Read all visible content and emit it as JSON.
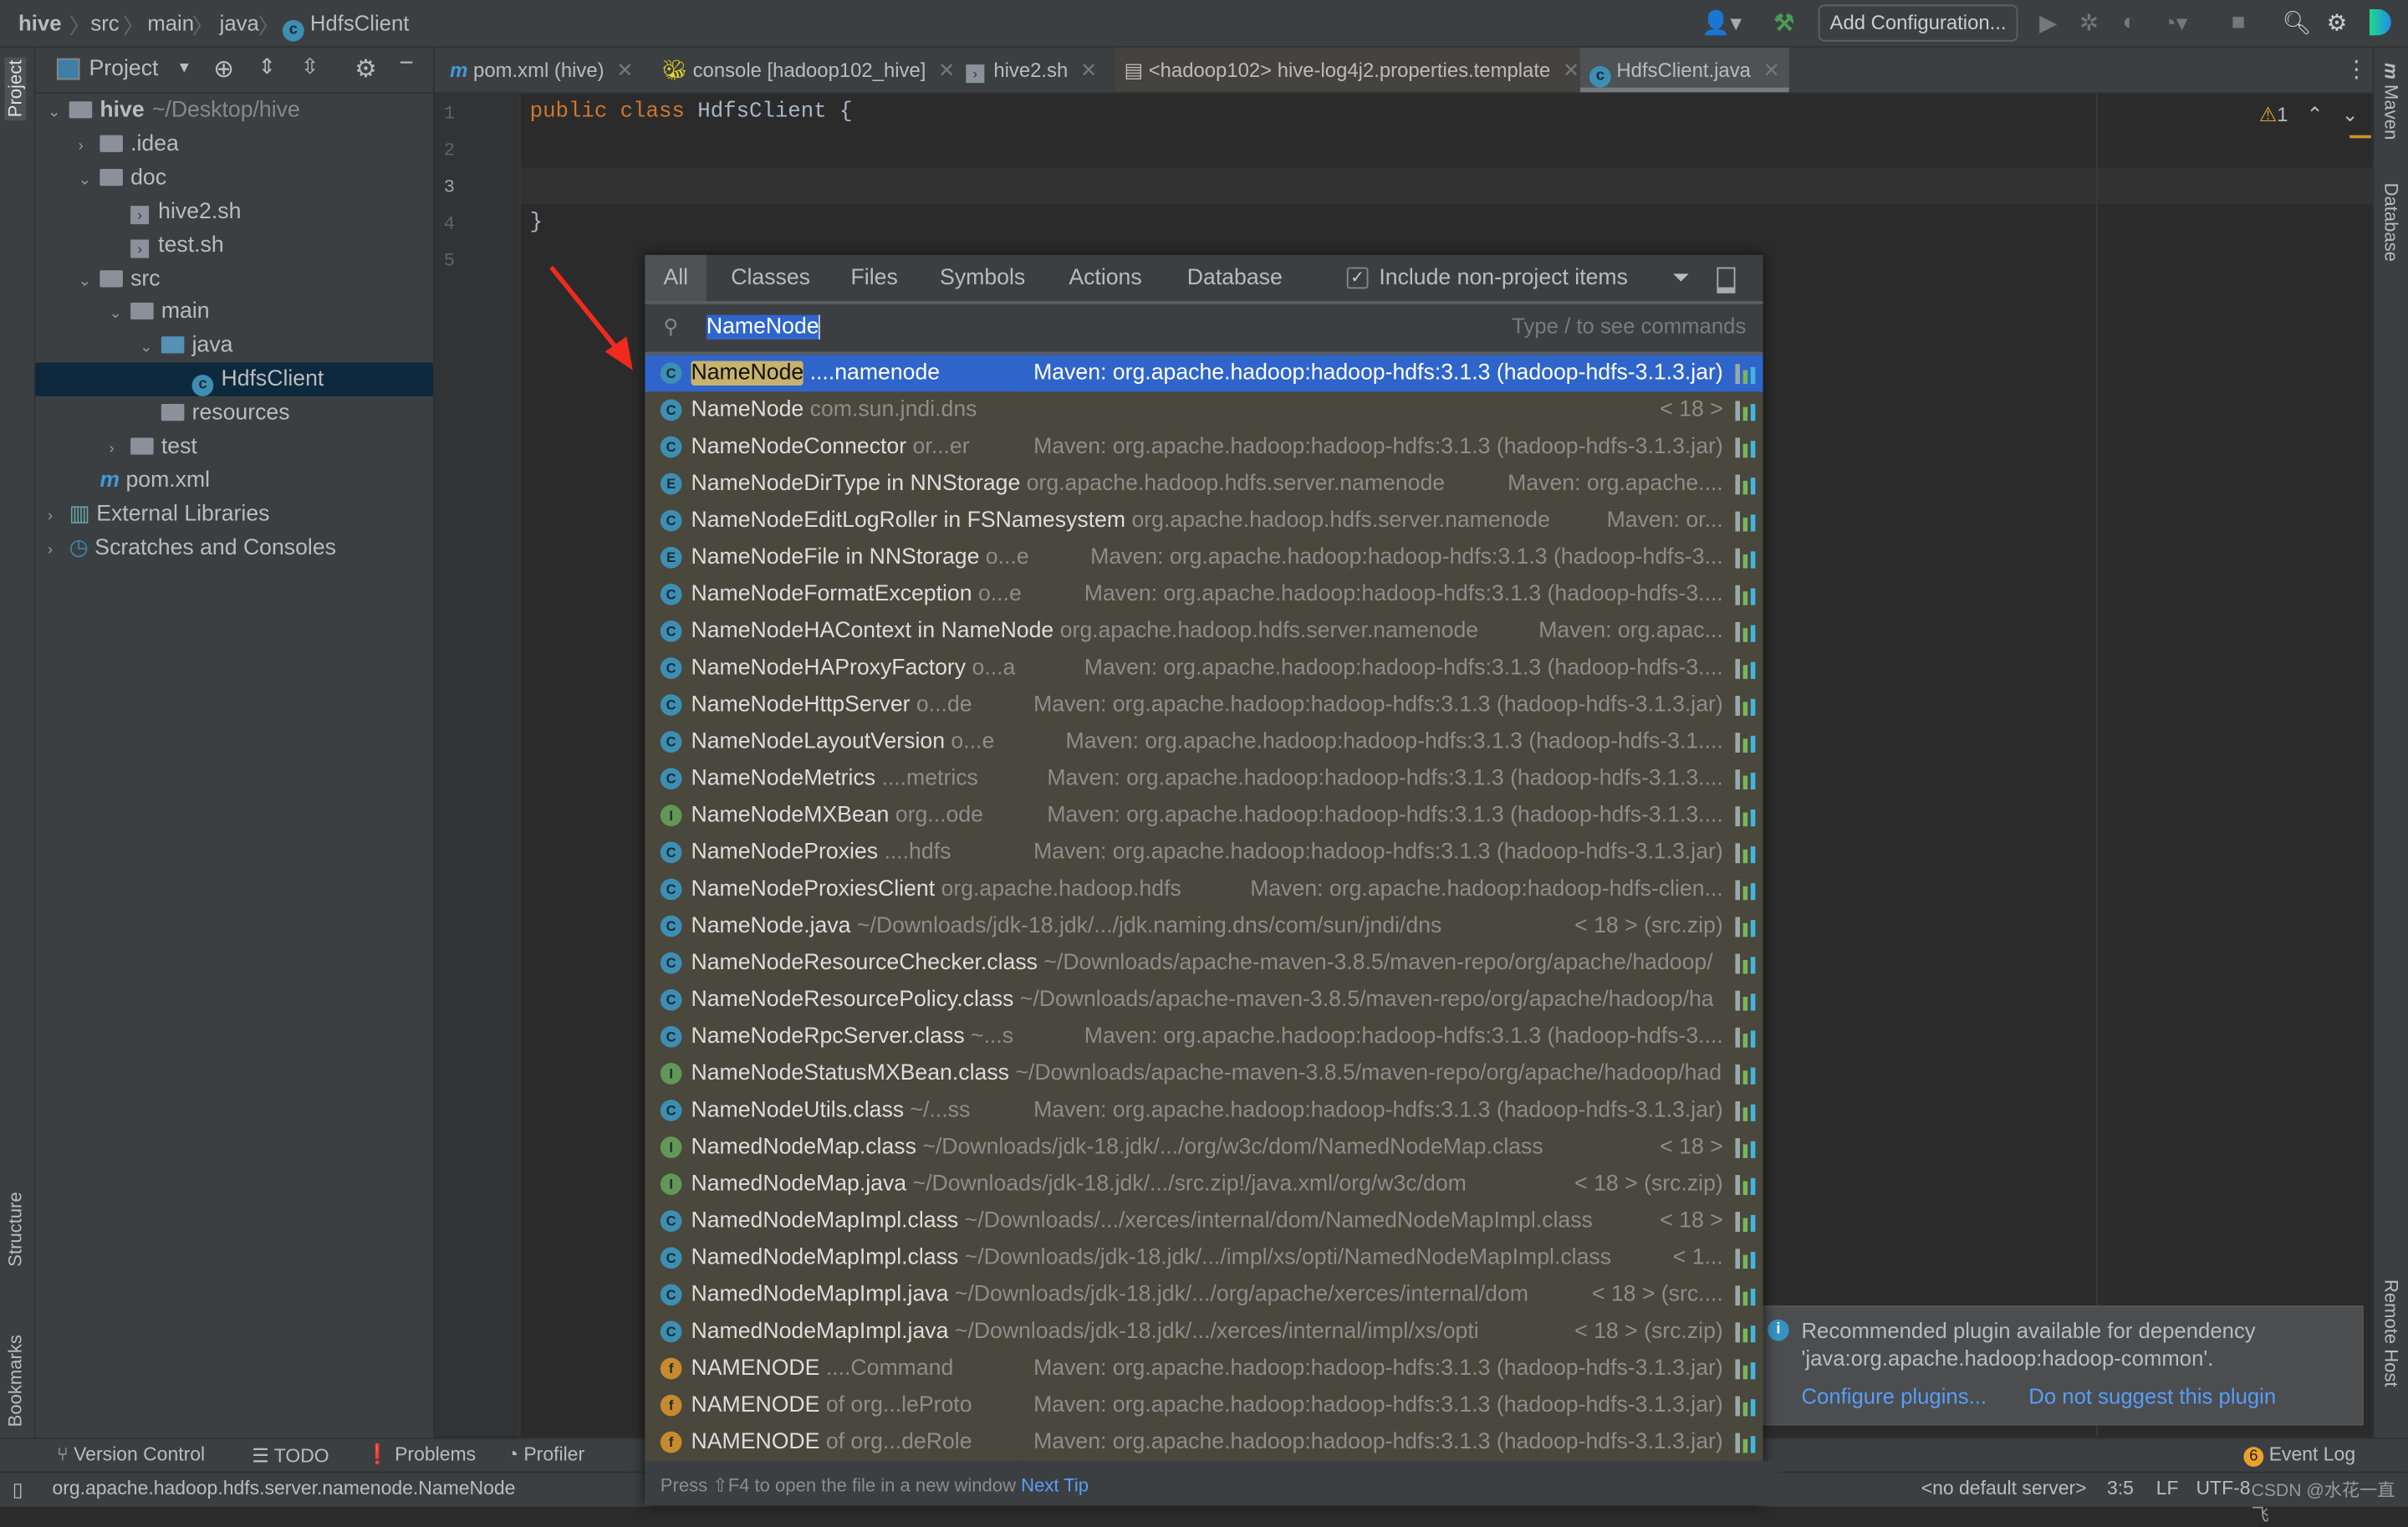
{
  "breadcrumb": [
    "hive",
    "src",
    "main",
    "java",
    "HdfsClient"
  ],
  "toolbar": {
    "add_configuration": "Add Configuration..."
  },
  "left_strip": {
    "project": "Project",
    "structure": "Structure",
    "bookmarks": "Bookmarks"
  },
  "right_strip": {
    "maven": "Maven",
    "database": "Database",
    "remote_host": "Remote Host"
  },
  "project_panel": {
    "title": "Project",
    "tree": [
      {
        "label": "hive",
        "extra": "~/Desktop/hive",
        "depth": 0,
        "type": "folder",
        "arrow": "down",
        "bold": true
      },
      {
        "label": ".idea",
        "depth": 1,
        "type": "folder",
        "arrow": "right"
      },
      {
        "label": "doc",
        "depth": 1,
        "type": "folder",
        "arrow": "down"
      },
      {
        "label": "hive2.sh",
        "depth": 2,
        "type": "sh"
      },
      {
        "label": "test.sh",
        "depth": 2,
        "type": "sh"
      },
      {
        "label": "src",
        "depth": 1,
        "type": "folder",
        "arrow": "down"
      },
      {
        "label": "main",
        "depth": 2,
        "type": "folder",
        "arrow": "down"
      },
      {
        "label": "java",
        "depth": 3,
        "type": "folder-blue",
        "arrow": "down"
      },
      {
        "label": "HdfsClient",
        "depth": 4,
        "type": "class",
        "selected": true
      },
      {
        "label": "resources",
        "depth": 3,
        "type": "folder"
      },
      {
        "label": "test",
        "depth": 2,
        "type": "folder",
        "arrow": "right"
      },
      {
        "label": "pom.xml",
        "depth": 1,
        "type": "maven"
      },
      {
        "label": "External Libraries",
        "depth": 0,
        "type": "lib",
        "arrow": "right"
      },
      {
        "label": "Scratches and Consoles",
        "depth": 0,
        "type": "scratch",
        "arrow": "right"
      }
    ]
  },
  "editor_tabs": [
    {
      "label": "pom.xml (hive)",
      "icon": "maven-icon"
    },
    {
      "label": "console [hadoop102_hive]",
      "icon": "hive-icon"
    },
    {
      "label": "hive2.sh",
      "icon": "shell-icon"
    },
    {
      "label": "<hadoop102> hive-log4j2.properties.template",
      "icon": "file-icon"
    },
    {
      "label": "HdfsClient.java",
      "icon": "class-icon",
      "active": true
    }
  ],
  "editor": {
    "lines": [
      "1",
      "2",
      "3",
      "4",
      "5"
    ],
    "code_line1_kw": "public class",
    "code_line1_name": " HdfsClient {",
    "code_line4": "}",
    "warnings": "1"
  },
  "search_popup": {
    "tabs": [
      "All",
      "Classes",
      "Files",
      "Symbols",
      "Actions",
      "Database"
    ],
    "include_non_project": "Include non-project items",
    "include_checked": true,
    "query": "NameNode",
    "hint": "Type / to see commands",
    "results": [
      {
        "icon": "C",
        "name": "NameNode",
        "detail": " ....namenode",
        "right": "Maven: org.apache.hadoop:hadoop-hdfs:3.1.3 (hadoop-hdfs-3.1.3.jar)",
        "selected": true
      },
      {
        "icon": "C",
        "name": "NameNode",
        "detail": " com.sun.jndi.dns",
        "right": "< 18 >"
      },
      {
        "icon": "C",
        "name": "NameNodeConnector",
        "detail": " or...er",
        "right": "Maven: org.apache.hadoop:hadoop-hdfs:3.1.3 (hadoop-hdfs-3.1.3.jar)"
      },
      {
        "icon": "E",
        "name": "NameNodeDirType in NNStorage",
        "detail": " org.apache.hadoop.hdfs.server.namenode",
        "right": "Maven: org.apache...."
      },
      {
        "icon": "C",
        "name": "NameNodeEditLogRoller in FSNamesystem",
        "detail": " org.apache.hadoop.hdfs.server.namenode",
        "right": "Maven: or..."
      },
      {
        "icon": "E",
        "name": "NameNodeFile in NNStorage",
        "detail": " o...e",
        "right": "Maven: org.apache.hadoop:hadoop-hdfs:3.1.3 (hadoop-hdfs-3..."
      },
      {
        "icon": "C",
        "name": "NameNodeFormatException",
        "detail": " o...e",
        "right": "Maven: org.apache.hadoop:hadoop-hdfs:3.1.3 (hadoop-hdfs-3...."
      },
      {
        "icon": "C",
        "name": "NameNodeHAContext in NameNode",
        "detail": " org.apache.hadoop.hdfs.server.namenode",
        "right": "Maven: org.apac..."
      },
      {
        "icon": "C",
        "name": "NameNodeHAProxyFactory",
        "detail": " o...a",
        "right": "Maven: org.apache.hadoop:hadoop-hdfs:3.1.3 (hadoop-hdfs-3...."
      },
      {
        "icon": "C",
        "name": "NameNodeHttpServer",
        "detail": " o...de",
        "right": "Maven: org.apache.hadoop:hadoop-hdfs:3.1.3 (hadoop-hdfs-3.1.3.jar)"
      },
      {
        "icon": "C",
        "name": "NameNodeLayoutVersion",
        "detail": " o...e",
        "right": "Maven: org.apache.hadoop:hadoop-hdfs:3.1.3 (hadoop-hdfs-3.1...."
      },
      {
        "icon": "C",
        "name": "NameNodeMetrics",
        "detail": " ....metrics",
        "right": "Maven: org.apache.hadoop:hadoop-hdfs:3.1.3 (hadoop-hdfs-3.1.3...."
      },
      {
        "icon": "I",
        "name": "NameNodeMXBean",
        "detail": " org...ode",
        "right": "Maven: org.apache.hadoop:hadoop-hdfs:3.1.3 (hadoop-hdfs-3.1.3...."
      },
      {
        "icon": "C",
        "name": "NameNodeProxies",
        "detail": " ....hdfs",
        "right": "Maven: org.apache.hadoop:hadoop-hdfs:3.1.3 (hadoop-hdfs-3.1.3.jar)"
      },
      {
        "icon": "C",
        "name": "NameNodeProxiesClient",
        "detail": " org.apache.hadoop.hdfs",
        "right": "Maven: org.apache.hadoop:hadoop-hdfs-clien..."
      },
      {
        "icon": "C",
        "name": "NameNode.java",
        "detail": " ~/Downloads/jdk-18.jdk/.../jdk.naming.dns/com/sun/jndi/dns",
        "right": "< 18 > (src.zip)"
      },
      {
        "icon": "C",
        "name": "NameNodeResourceChecker.class",
        "detail": " ~/Downloads/apache-maven-3.8.5/maven-repo/org/apache/hadoop/",
        "right": ""
      },
      {
        "icon": "C",
        "name": "NameNodeResourcePolicy.class",
        "detail": " ~/Downloads/apache-maven-3.8.5/maven-repo/org/apache/hadoop/ha",
        "right": ""
      },
      {
        "icon": "C",
        "name": "NameNodeRpcServer.class",
        "detail": " ~...s",
        "right": "Maven: org.apache.hadoop:hadoop-hdfs:3.1.3 (hadoop-hdfs-3...."
      },
      {
        "icon": "I",
        "name": "NameNodeStatusMXBean.class",
        "detail": " ~/Downloads/apache-maven-3.8.5/maven-repo/org/apache/hadoop/had",
        "right": ""
      },
      {
        "icon": "C",
        "name": "NameNodeUtils.class",
        "detail": " ~/...ss",
        "right": "Maven: org.apache.hadoop:hadoop-hdfs:3.1.3 (hadoop-hdfs-3.1.3.jar)"
      },
      {
        "icon": "I",
        "name": "NamedNodeMap.class",
        "detail": " ~/Downloads/jdk-18.jdk/.../org/w3c/dom/NamedNodeMap.class",
        "right": "< 18 >"
      },
      {
        "icon": "I",
        "name": "NamedNodeMap.java",
        "detail": " ~/Downloads/jdk-18.jdk/.../src.zip!/java.xml/org/w3c/dom",
        "right": "< 18 > (src.zip)"
      },
      {
        "icon": "C",
        "name": "NamedNodeMapImpl.class",
        "detail": " ~/Downloads/.../xerces/internal/dom/NamedNodeMapImpl.class",
        "right": "< 18 >"
      },
      {
        "icon": "C",
        "name": "NamedNodeMapImpl.class",
        "detail": " ~/Downloads/jdk-18.jdk/.../impl/xs/opti/NamedNodeMapImpl.class",
        "right": "< 1..."
      },
      {
        "icon": "C",
        "name": "NamedNodeMapImpl.java",
        "detail": " ~/Downloads/jdk-18.jdk/.../org/apache/xerces/internal/dom",
        "right": "< 18 > (src...."
      },
      {
        "icon": "C",
        "name": "NamedNodeMapImpl.java",
        "detail": " ~/Downloads/jdk-18.jdk/.../xerces/internal/impl/xs/opti",
        "right": "< 18 > (src.zip)"
      },
      {
        "icon": "f",
        "name": "NAMENODE",
        "detail": " ....Command",
        "right": "Maven: org.apache.hadoop:hadoop-hdfs:3.1.3 (hadoop-hdfs-3.1.3.jar)"
      },
      {
        "icon": "f",
        "name": "NAMENODE",
        "detail": " of org...leProto",
        "right": "Maven: org.apache.hadoop:hadoop-hdfs:3.1.3 (hadoop-hdfs-3.1.3.jar)"
      },
      {
        "icon": "f",
        "name": "NAMENODE",
        "detail": " of org...deRole",
        "right": "Maven: org.apache.hadoop:hadoop-hdfs:3.1.3 (hadoop-hdfs-3.1.3.jar)"
      }
    ],
    "footer_tip": "Press ⇧F4 to open the file in a new window",
    "next_tip": "Next Tip"
  },
  "notification": {
    "line1": "Recommended plugin available for dependency",
    "line2": "'java:org.apache.hadoop:hadoop-common'.",
    "configure": "Configure plugins...",
    "dismiss": "Do not suggest this plugin"
  },
  "bottom_tools": [
    "Version Control",
    "TODO",
    "Problems",
    "Profiler"
  ],
  "event_log": {
    "count": "6",
    "label": "Event Log"
  },
  "status": {
    "path": "org.apache.hadoop.hdfs.server.namenode.NameNode",
    "server": "<no default server>",
    "position": "3:5",
    "line_sep": "LF",
    "encoding": "UTF-8",
    "watermark": "CSDN @水花一直飞"
  },
  "colors": {
    "selection": "#2f65ca",
    "list_bg": "#4a473c",
    "link": "#589df6",
    "match_highlight": "#c8b26e"
  }
}
